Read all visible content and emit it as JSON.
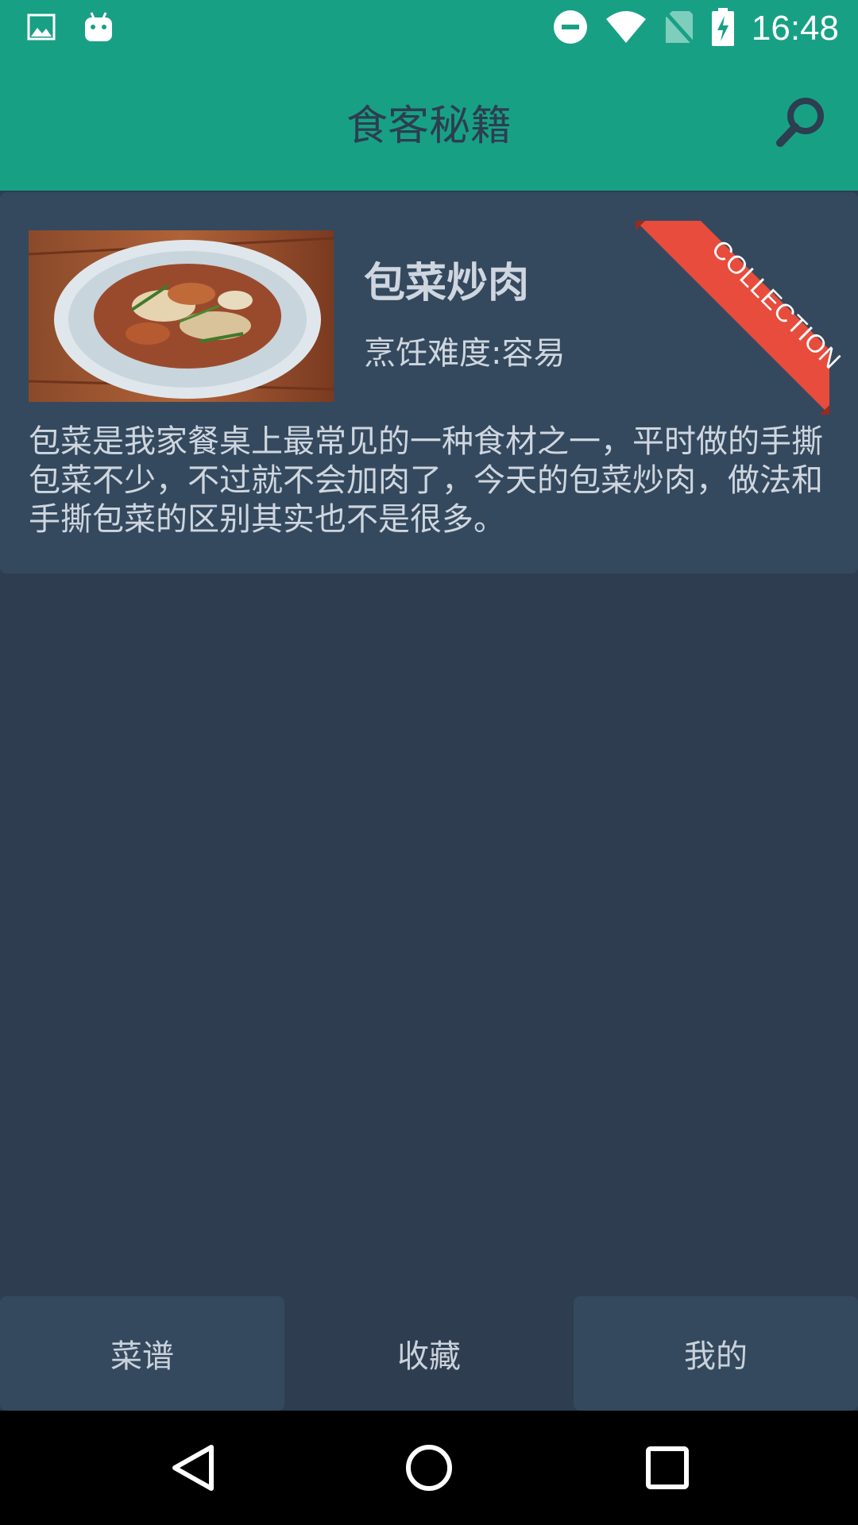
{
  "status_bar": {
    "time": "16:48",
    "icons": [
      "image-icon",
      "android-icon",
      "do-not-disturb-icon",
      "wifi-icon",
      "no-sim-icon",
      "battery-charging-icon"
    ]
  },
  "app_bar": {
    "title": "食客秘籍",
    "search_icon": "search-icon"
  },
  "recipe_card": {
    "name": "包菜炒肉",
    "difficulty": "烹饪难度:容易",
    "ribbon": "COLLECTION",
    "description": "包菜是我家餐桌上最常见的一种食材之一，平时做的手撕包菜不少，不过就不会加肉了，今天的包菜炒肉，做法和手撕包菜的区别其实也不是很多。"
  },
  "tabs": [
    {
      "label": "菜谱"
    },
    {
      "label": "收藏"
    },
    {
      "label": "我的"
    }
  ],
  "nav_bar": {
    "icons": [
      "back-icon",
      "home-icon",
      "recents-icon"
    ]
  },
  "colors": {
    "primary": "#18a085",
    "background": "#2e3d50",
    "card": "#34495e",
    "ribbon": "#e74c3c",
    "nav": "#000000"
  }
}
